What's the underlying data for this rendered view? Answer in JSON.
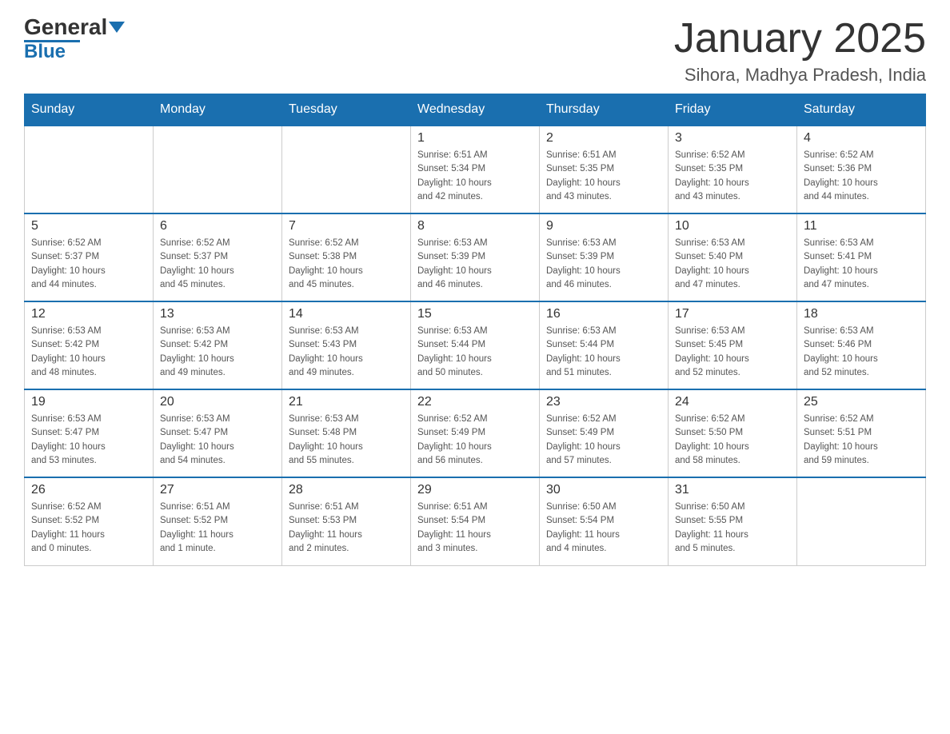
{
  "header": {
    "logo_main": "General",
    "logo_accent": "Blue",
    "title": "January 2025",
    "subtitle": "Sihora, Madhya Pradesh, India"
  },
  "columns": [
    "Sunday",
    "Monday",
    "Tuesday",
    "Wednesday",
    "Thursday",
    "Friday",
    "Saturday"
  ],
  "weeks": [
    [
      {
        "day": "",
        "info": ""
      },
      {
        "day": "",
        "info": ""
      },
      {
        "day": "",
        "info": ""
      },
      {
        "day": "1",
        "info": "Sunrise: 6:51 AM\nSunset: 5:34 PM\nDaylight: 10 hours\nand 42 minutes."
      },
      {
        "day": "2",
        "info": "Sunrise: 6:51 AM\nSunset: 5:35 PM\nDaylight: 10 hours\nand 43 minutes."
      },
      {
        "day": "3",
        "info": "Sunrise: 6:52 AM\nSunset: 5:35 PM\nDaylight: 10 hours\nand 43 minutes."
      },
      {
        "day": "4",
        "info": "Sunrise: 6:52 AM\nSunset: 5:36 PM\nDaylight: 10 hours\nand 44 minutes."
      }
    ],
    [
      {
        "day": "5",
        "info": "Sunrise: 6:52 AM\nSunset: 5:37 PM\nDaylight: 10 hours\nand 44 minutes."
      },
      {
        "day": "6",
        "info": "Sunrise: 6:52 AM\nSunset: 5:37 PM\nDaylight: 10 hours\nand 45 minutes."
      },
      {
        "day": "7",
        "info": "Sunrise: 6:52 AM\nSunset: 5:38 PM\nDaylight: 10 hours\nand 45 minutes."
      },
      {
        "day": "8",
        "info": "Sunrise: 6:53 AM\nSunset: 5:39 PM\nDaylight: 10 hours\nand 46 minutes."
      },
      {
        "day": "9",
        "info": "Sunrise: 6:53 AM\nSunset: 5:39 PM\nDaylight: 10 hours\nand 46 minutes."
      },
      {
        "day": "10",
        "info": "Sunrise: 6:53 AM\nSunset: 5:40 PM\nDaylight: 10 hours\nand 47 minutes."
      },
      {
        "day": "11",
        "info": "Sunrise: 6:53 AM\nSunset: 5:41 PM\nDaylight: 10 hours\nand 47 minutes."
      }
    ],
    [
      {
        "day": "12",
        "info": "Sunrise: 6:53 AM\nSunset: 5:42 PM\nDaylight: 10 hours\nand 48 minutes."
      },
      {
        "day": "13",
        "info": "Sunrise: 6:53 AM\nSunset: 5:42 PM\nDaylight: 10 hours\nand 49 minutes."
      },
      {
        "day": "14",
        "info": "Sunrise: 6:53 AM\nSunset: 5:43 PM\nDaylight: 10 hours\nand 49 minutes."
      },
      {
        "day": "15",
        "info": "Sunrise: 6:53 AM\nSunset: 5:44 PM\nDaylight: 10 hours\nand 50 minutes."
      },
      {
        "day": "16",
        "info": "Sunrise: 6:53 AM\nSunset: 5:44 PM\nDaylight: 10 hours\nand 51 minutes."
      },
      {
        "day": "17",
        "info": "Sunrise: 6:53 AM\nSunset: 5:45 PM\nDaylight: 10 hours\nand 52 minutes."
      },
      {
        "day": "18",
        "info": "Sunrise: 6:53 AM\nSunset: 5:46 PM\nDaylight: 10 hours\nand 52 minutes."
      }
    ],
    [
      {
        "day": "19",
        "info": "Sunrise: 6:53 AM\nSunset: 5:47 PM\nDaylight: 10 hours\nand 53 minutes."
      },
      {
        "day": "20",
        "info": "Sunrise: 6:53 AM\nSunset: 5:47 PM\nDaylight: 10 hours\nand 54 minutes."
      },
      {
        "day": "21",
        "info": "Sunrise: 6:53 AM\nSunset: 5:48 PM\nDaylight: 10 hours\nand 55 minutes."
      },
      {
        "day": "22",
        "info": "Sunrise: 6:52 AM\nSunset: 5:49 PM\nDaylight: 10 hours\nand 56 minutes."
      },
      {
        "day": "23",
        "info": "Sunrise: 6:52 AM\nSunset: 5:49 PM\nDaylight: 10 hours\nand 57 minutes."
      },
      {
        "day": "24",
        "info": "Sunrise: 6:52 AM\nSunset: 5:50 PM\nDaylight: 10 hours\nand 58 minutes."
      },
      {
        "day": "25",
        "info": "Sunrise: 6:52 AM\nSunset: 5:51 PM\nDaylight: 10 hours\nand 59 minutes."
      }
    ],
    [
      {
        "day": "26",
        "info": "Sunrise: 6:52 AM\nSunset: 5:52 PM\nDaylight: 11 hours\nand 0 minutes."
      },
      {
        "day": "27",
        "info": "Sunrise: 6:51 AM\nSunset: 5:52 PM\nDaylight: 11 hours\nand 1 minute."
      },
      {
        "day": "28",
        "info": "Sunrise: 6:51 AM\nSunset: 5:53 PM\nDaylight: 11 hours\nand 2 minutes."
      },
      {
        "day": "29",
        "info": "Sunrise: 6:51 AM\nSunset: 5:54 PM\nDaylight: 11 hours\nand 3 minutes."
      },
      {
        "day": "30",
        "info": "Sunrise: 6:50 AM\nSunset: 5:54 PM\nDaylight: 11 hours\nand 4 minutes."
      },
      {
        "day": "31",
        "info": "Sunrise: 6:50 AM\nSunset: 5:55 PM\nDaylight: 11 hours\nand 5 minutes."
      },
      {
        "day": "",
        "info": ""
      }
    ]
  ]
}
